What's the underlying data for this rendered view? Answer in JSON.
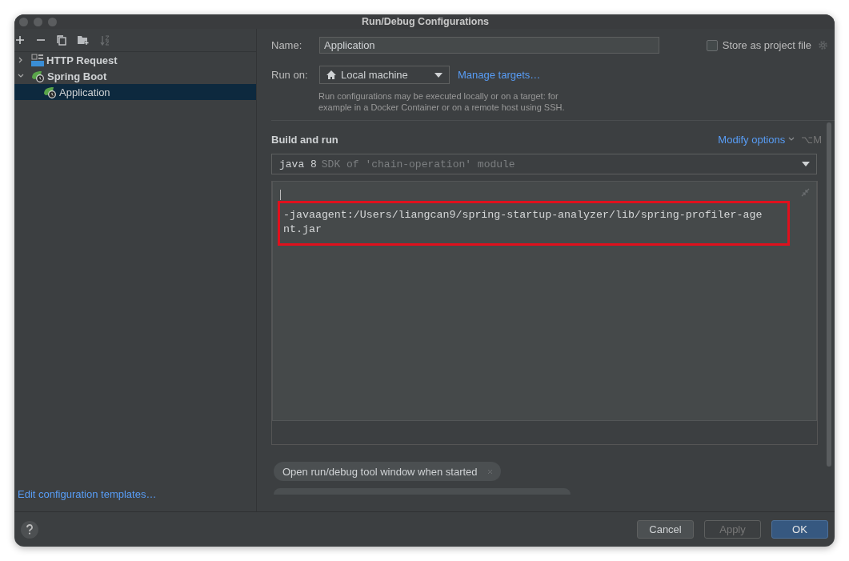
{
  "window": {
    "title": "Run/Debug Configurations"
  },
  "tree": [
    {
      "label": "HTTP Request",
      "kind": "http",
      "expanded": false,
      "selected": false
    },
    {
      "label": "Spring Boot",
      "kind": "spring",
      "expanded": true,
      "selected": false,
      "children": [
        {
          "label": "Application",
          "kind": "spring",
          "selected": true
        }
      ]
    }
  ],
  "edit_templates_link": "Edit configuration templates…",
  "form": {
    "name_label": "Name:",
    "name_value": "Application",
    "store_as_project_file": {
      "label": "Store as project file",
      "checked": false
    },
    "run_on_label": "Run on:",
    "run_on_value": "Local machine",
    "manage_targets_link": "Manage targets…",
    "hint": "Run configurations may be executed locally or on a target: for example in a Docker Container or on a remote host using SSH."
  },
  "build_and_run": {
    "title": "Build and run",
    "modify_options": "Modify options",
    "shortcut": "⌥M",
    "sdk": {
      "value": "java 8",
      "hint": "SDK of 'chain-operation' module"
    },
    "vm_options": {
      "lines": [
        "-javaagent:/Users/liangcan9/spring-startup-analyzer/lib/spring-profiler-age",
        "nt.jar"
      ],
      "highlighted": true
    }
  },
  "chips": [
    {
      "label": "Open run/debug tool window when started"
    }
  ],
  "buttons": [
    {
      "label": "Cancel",
      "kind": "normal"
    },
    {
      "label": "Apply",
      "kind": "disabled"
    },
    {
      "label": "OK",
      "kind": "default"
    }
  ]
}
